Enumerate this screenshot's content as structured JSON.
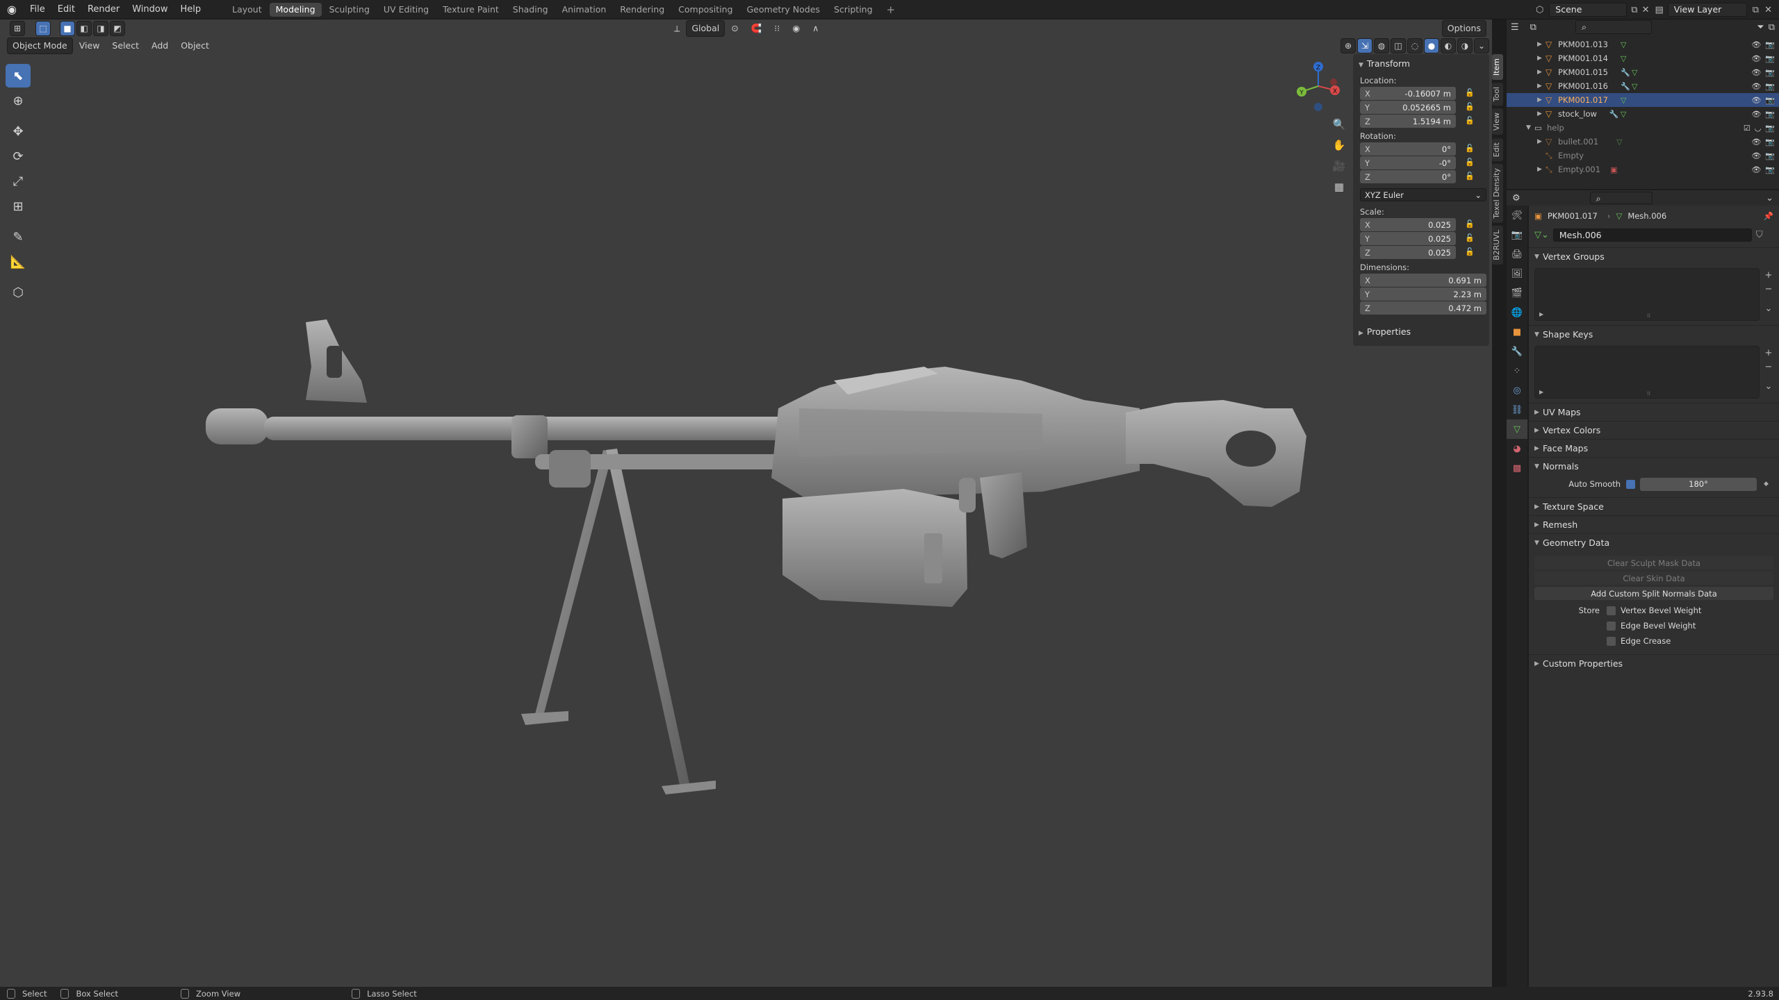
{
  "topbar": {
    "menus": [
      "File",
      "Edit",
      "Render",
      "Window",
      "Help"
    ],
    "workspaces": [
      "Layout",
      "Modeling",
      "Sculpting",
      "UV Editing",
      "Texture Paint",
      "Shading",
      "Animation",
      "Rendering",
      "Compositing",
      "Geometry Nodes",
      "Scripting"
    ],
    "active_workspace": "Modeling",
    "scene": "Scene",
    "view_layer": "View Layer"
  },
  "viewport": {
    "mode": "Object Mode",
    "menus": [
      "View",
      "Select",
      "Add",
      "Object"
    ],
    "orientation": "Global",
    "options_label": "Options"
  },
  "transform": {
    "title": "Transform",
    "location_label": "Location:",
    "location": {
      "x": "-0.16007 m",
      "y": "0.052665 m",
      "z": "1.5194 m"
    },
    "rotation_label": "Rotation:",
    "rotation": {
      "x": "0°",
      "y": "-0°",
      "z": "0°"
    },
    "rotation_mode": "XYZ Euler",
    "scale_label": "Scale:",
    "scale": {
      "x": "0.025",
      "y": "0.025",
      "z": "0.025"
    },
    "dimensions_label": "Dimensions:",
    "dimensions": {
      "x": "0.691 m",
      "y": "2.23 m",
      "z": "0.472 m"
    },
    "properties_label": "Properties"
  },
  "axis_letters": {
    "x": "X",
    "y": "Y",
    "z": "Z"
  },
  "n_tabs": [
    "Item",
    "Tool",
    "View",
    "Edit",
    "Texel Density",
    "B2RUVL"
  ],
  "outliner": {
    "rows": [
      {
        "name": "PKM001.013",
        "selected": false
      },
      {
        "name": "PKM001.014",
        "selected": false
      },
      {
        "name": "PKM001.015",
        "selected": false
      },
      {
        "name": "PKM001.016",
        "selected": false
      },
      {
        "name": "PKM001.017",
        "selected": true
      },
      {
        "name": "stock_low",
        "selected": false
      }
    ],
    "collection": "help",
    "collection_children": [
      "bullet.001",
      "Empty",
      "Empty.001"
    ]
  },
  "properties": {
    "object_name": "PKM001.017",
    "mesh_name": "Mesh.006",
    "mesh_datablock": "Mesh.006",
    "sections": {
      "vertex_groups": "Vertex Groups",
      "shape_keys": "Shape Keys",
      "uv_maps": "UV Maps",
      "vertex_colors": "Vertex Colors",
      "face_maps": "Face Maps",
      "normals": "Normals",
      "texture_space": "Texture Space",
      "remesh": "Remesh",
      "geometry_data": "Geometry Data",
      "custom_properties": "Custom Properties"
    },
    "auto_smooth_label": "Auto Smooth",
    "auto_smooth_angle": "180°",
    "clear_sculpt": "Clear Sculpt Mask Data",
    "clear_skin": "Clear Skin Data",
    "add_split_normals": "Add Custom Split Normals Data",
    "store_label": "Store",
    "store_options": [
      "Vertex Bevel Weight",
      "Edge Bevel Weight",
      "Edge Crease"
    ]
  },
  "status": {
    "items": [
      "Select",
      "Box Select",
      "Zoom View",
      "Lasso Select"
    ],
    "version": "2.93.8"
  }
}
